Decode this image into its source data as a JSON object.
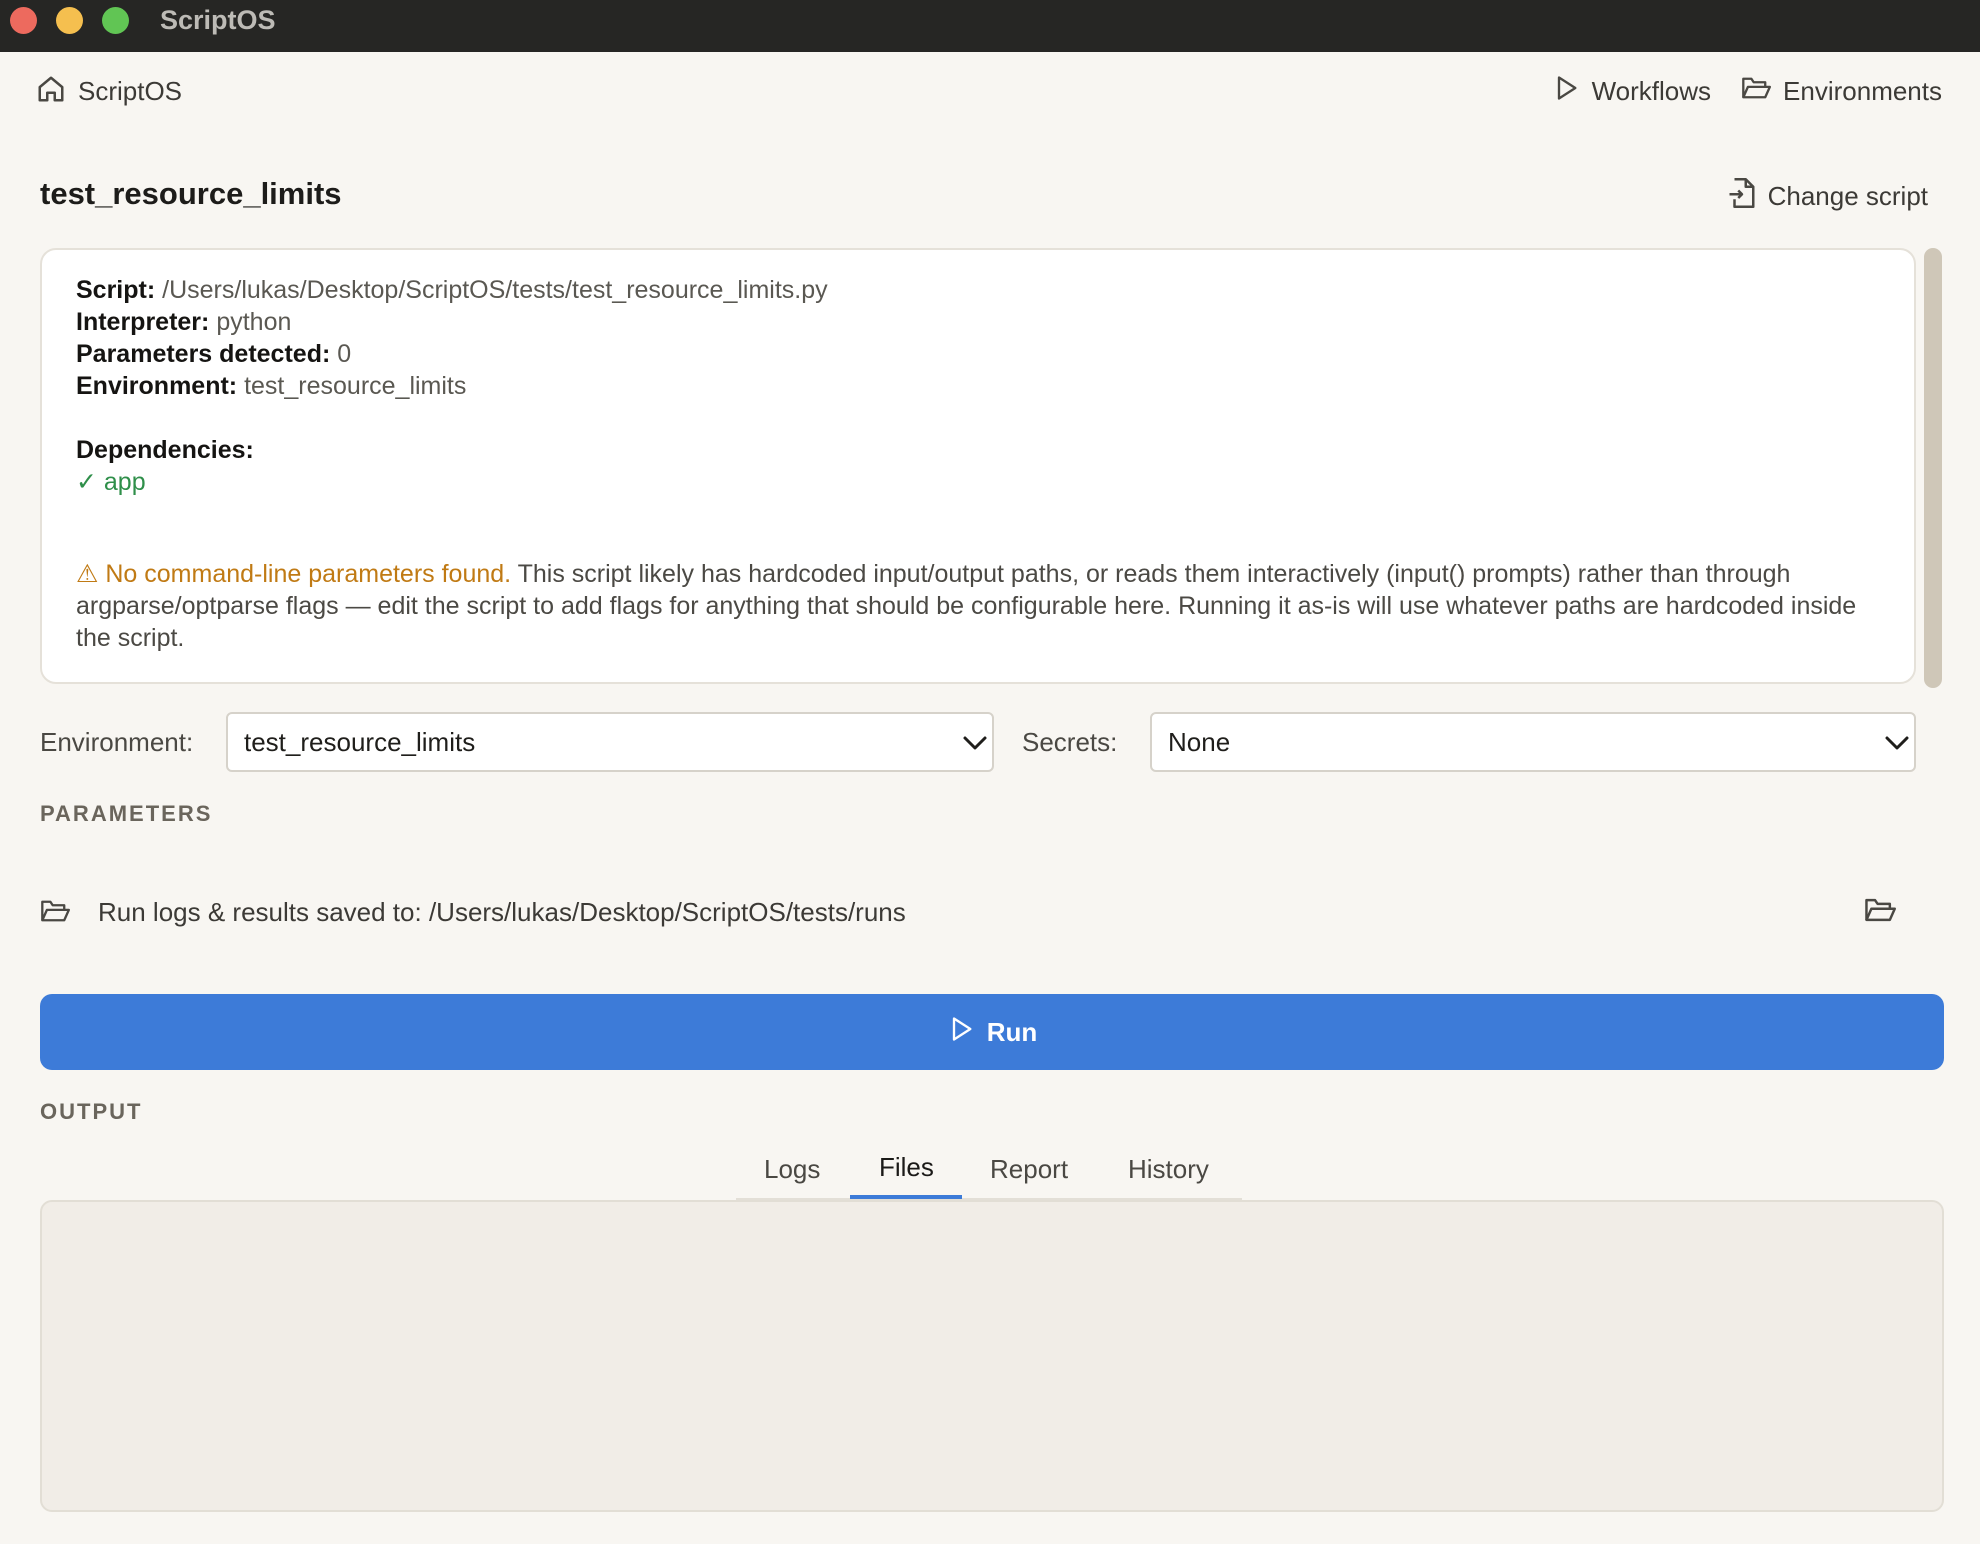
{
  "window": {
    "title": "ScriptOS"
  },
  "nav": {
    "home_label": "ScriptOS",
    "workflows_label": "Workflows",
    "environments_label": "Environments"
  },
  "page": {
    "title": "test_resource_limits",
    "change_script_label": "Change script"
  },
  "info": {
    "script_key": "Script:",
    "script_value": "/Users/lukas/Desktop/ScriptOS/tests/test_resource_limits.py",
    "interpreter_key": "Interpreter:",
    "interpreter_value": "python",
    "params_key": "Parameters detected:",
    "params_value": "0",
    "env_key": "Environment:",
    "env_value": "test_resource_limits",
    "dependencies_title": "Dependencies:",
    "dependencies": [
      "✓ app"
    ],
    "warning_head": "⚠ No command-line parameters found.",
    "warning_body": " This script likely has hardcoded input/output paths, or reads them interactively (input() prompts) rather than through argparse/optparse flags — edit the script to add flags for anything that should be configurable here. Running it as-is will use whatever paths are hardcoded inside the script."
  },
  "controls": {
    "environment_label": "Environment:",
    "environment_value": "test_resource_limits",
    "secrets_label": "Secrets:",
    "secrets_value": "None"
  },
  "parameters": {
    "section_label": "PARAMETERS"
  },
  "save": {
    "text": "Run logs & results saved to: /Users/lukas/Desktop/ScriptOS/tests/runs"
  },
  "run": {
    "label": "Run"
  },
  "output": {
    "section_label": "OUTPUT",
    "tabs": [
      {
        "label": "Logs",
        "active": false
      },
      {
        "label": "Files",
        "active": true
      },
      {
        "label": "Report",
        "active": false
      },
      {
        "label": "History",
        "active": false
      }
    ]
  },
  "colors": {
    "accent": "#3d7bd8",
    "warning": "#c07a14",
    "success": "#2f8f4a",
    "titlebar": "#262624",
    "background": "#f8f6f2"
  }
}
